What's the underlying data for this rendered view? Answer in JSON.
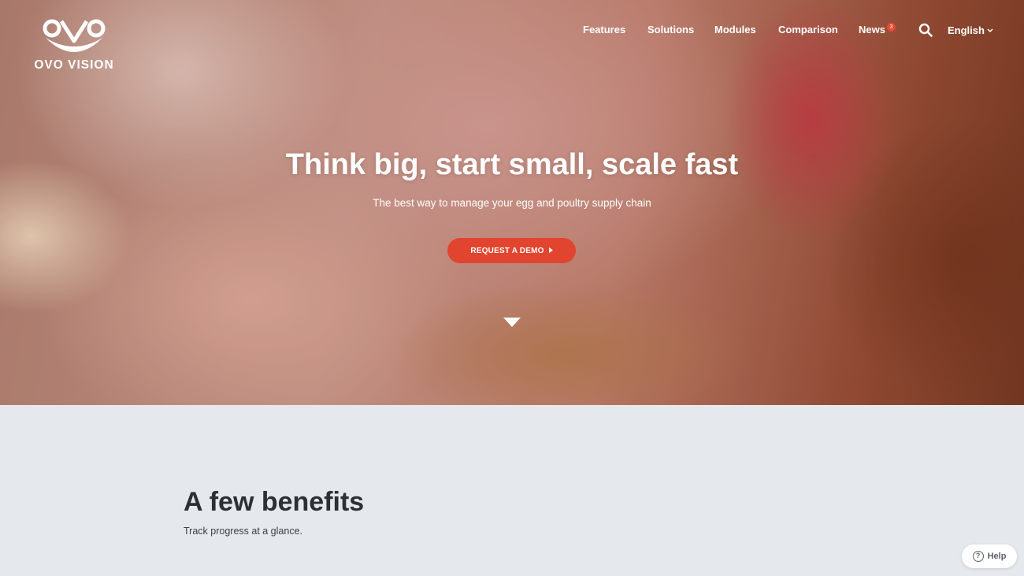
{
  "brand": {
    "name": "OVO VISION",
    "accent": "#e1452f"
  },
  "nav": {
    "items": [
      {
        "label": "Features"
      },
      {
        "label": "Solutions"
      },
      {
        "label": "Modules"
      },
      {
        "label": "Comparison"
      },
      {
        "label": "News"
      }
    ],
    "news_badge": "3",
    "search_icon": "search-icon",
    "language": "English"
  },
  "hero": {
    "title": "Think big, start small, scale fast",
    "subtitle": "The best way to manage your egg and poultry supply chain",
    "cta_label": "REQUEST A DEMO"
  },
  "benefits": {
    "title": "A few benefits",
    "subtitle": "Track progress at a glance."
  },
  "help": {
    "label": "Help"
  }
}
